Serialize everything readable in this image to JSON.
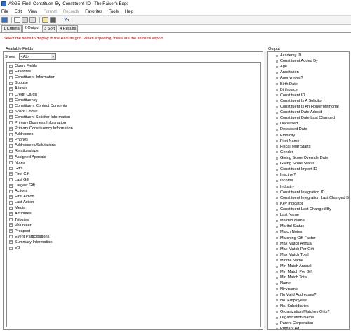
{
  "window": {
    "title": "ASGE_Find_Constituen_By_Constituent_ID - The Raiser's Edge"
  },
  "menu": [
    {
      "label": "File",
      "enabled": true
    },
    {
      "label": "Edit",
      "enabled": true
    },
    {
      "label": "View",
      "enabled": true
    },
    {
      "label": "Format",
      "enabled": false
    },
    {
      "label": "Records",
      "enabled": false
    },
    {
      "label": "Favorites",
      "enabled": true
    },
    {
      "label": "Tools",
      "enabled": true
    },
    {
      "label": "Help",
      "enabled": true
    }
  ],
  "toolbar": {
    "buttons": [
      "save-icon",
      "new-icon",
      "print-icon",
      "export-icon",
      "properties-icon",
      "find-icon"
    ],
    "help_label": "?"
  },
  "tabs": [
    {
      "label": "1 Criteria",
      "active": false
    },
    {
      "label": "2 Output",
      "active": true
    },
    {
      "label": "3 Sort",
      "active": false
    },
    {
      "label": "4 Results",
      "active": false
    }
  ],
  "instruction": "Select the fields to display in the Results grid.  When exporting, these are the fields to export.",
  "available_fields": {
    "label": "Available Fields",
    "show_label": "Show:",
    "show_value": "<All>",
    "items": [
      "Query Fields",
      "Favorites",
      "Constituent Information",
      "Spouse",
      "Aliases",
      "Credit Cards",
      "Constituency",
      "Constituent Contact Consents",
      "Solicit Codes",
      "Constituent Solicitor Information",
      "Primary Business Information",
      "Primary Constituency Information",
      "Addresses",
      "Phones",
      "Addressees/Salutations",
      "Relationships",
      "Assigned Appeals",
      "Notes",
      "Gifts",
      "First Gift",
      "Last Gift",
      "Largest Gift",
      "Actions",
      "First Action",
      "Last Action",
      "Media",
      "Attributes",
      "Tributes",
      "Volunteer",
      "Prospect",
      "Event Participations",
      "Summary Information",
      "VB"
    ]
  },
  "output": {
    "label": "Output",
    "items": [
      "Academy ID",
      "Constituent Added By",
      "Age",
      "Annotation",
      "Anonymous?",
      "Birth Date",
      "Birthplace",
      "Constituent ID",
      "Constituent Is A Solicitor",
      "Constituent Is An Honor/Memorial",
      "Constituent Date Added",
      "Constituent Date Last Changed",
      "Deceased",
      "Deceased Date",
      "Ethnicity",
      "First Name",
      "Fiscal Year Starts",
      "Gender",
      "Giving Score Override Date",
      "Giving Score Status",
      "Constituent Import ID",
      "Inactive?",
      "Income",
      "Industry",
      "Constituent Integration ID",
      "Constituent Integration Last Changed By",
      "Key Indicator",
      "Constituent Last Changed By",
      "Last Name",
      "Maiden Name",
      "Marital Status",
      "Match Notes",
      "Matching Gift Factor",
      "Max Match Annual",
      "Max Match Per Gift",
      "Max Match Total",
      "Middle Name",
      "Min Match Annual",
      "Min Match Per Gift",
      "Min Match Total",
      "Name",
      "Nickname",
      "No Valid Addresses?",
      "No. Employees",
      "No. Subsidiaries",
      "Organization Matches Gifts?",
      "Organization Name",
      "Parent Corporation",
      "Primary Ad..."
    ]
  },
  "colors": {
    "instruction_text": "#c00000",
    "app_icon": "#2f6fc4"
  }
}
